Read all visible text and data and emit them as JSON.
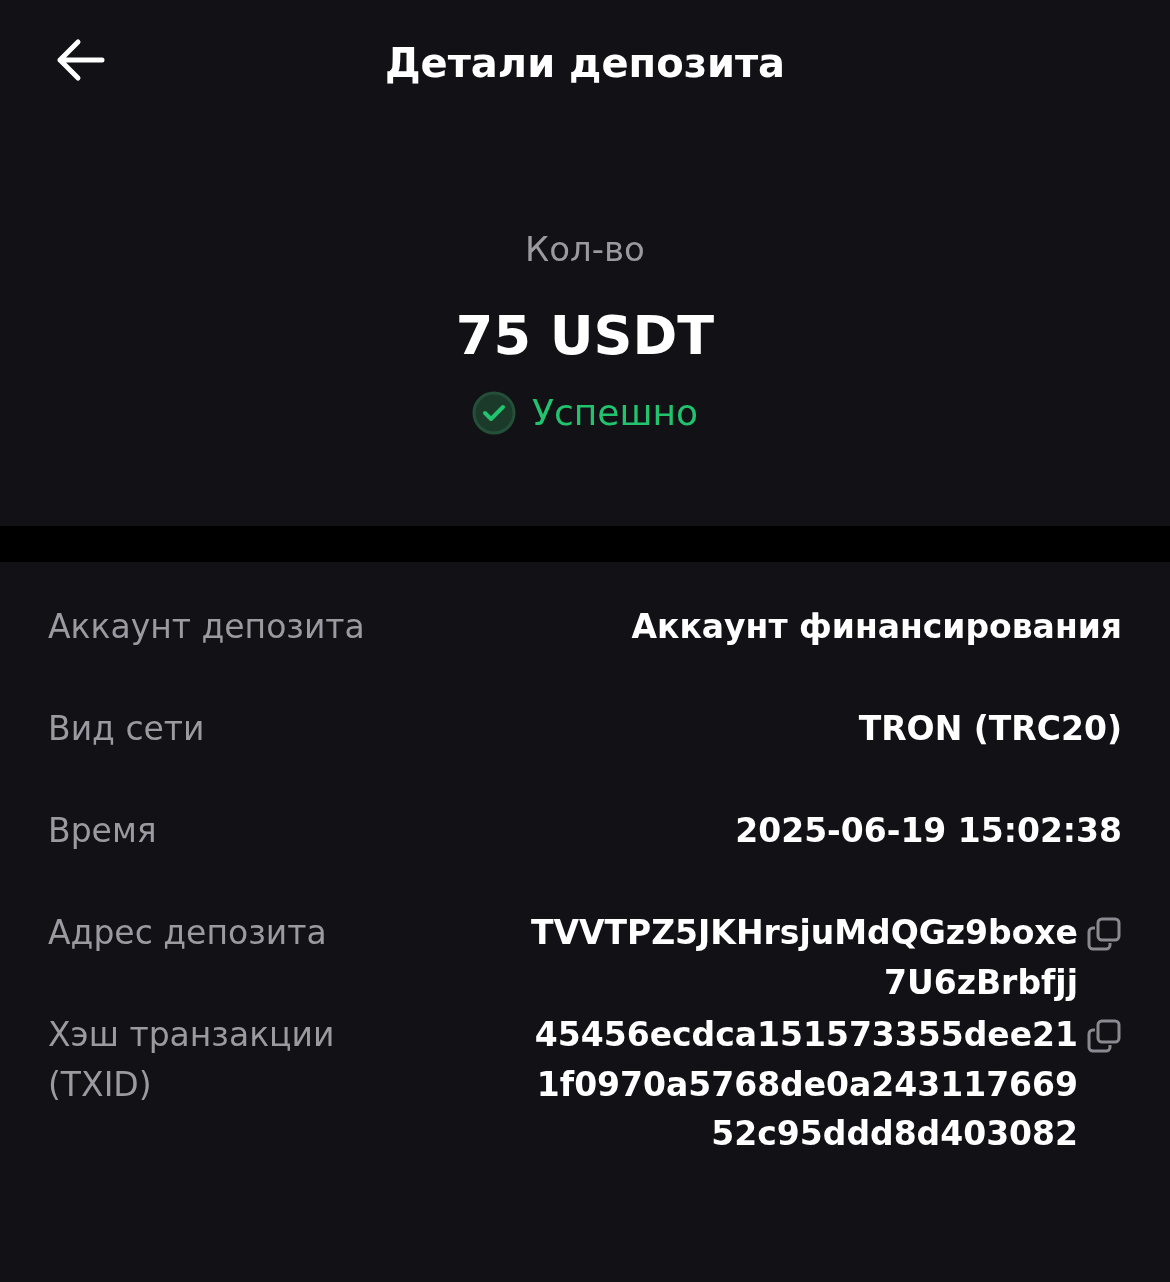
{
  "header": {
    "title": "Детали депозита"
  },
  "summary": {
    "label": "Кол-во",
    "amount": "75 USDT",
    "status": {
      "kind": "success",
      "text": "Успешно"
    }
  },
  "details": [
    {
      "label": "Аккаунт депозита",
      "value": "Аккаунт финансирования",
      "copyable": false
    },
    {
      "label": "Вид сети",
      "value": "TRON (TRC20)",
      "copyable": false
    },
    {
      "label": "Время",
      "value": "2025-06-19 15:02:38",
      "copyable": false
    },
    {
      "label": "Адрес депозита",
      "value": "TVVTPZ5JKHrsjuMdQGz9boxe7U6zBrbfjj",
      "copyable": true
    },
    {
      "label": "Хэш транзакции (TXID)",
      "value": "45456ecdca151573355dee211f0970a5768de0a24311766952c95ddd8d403082",
      "copyable": true
    }
  ]
}
